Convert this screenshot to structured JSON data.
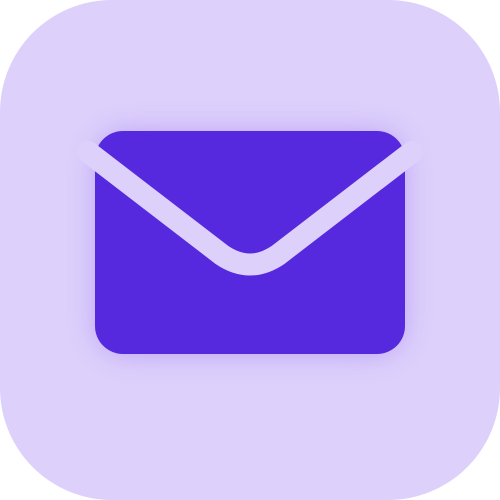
{
  "app_icon": {
    "icon_name": "envelope-icon",
    "meaning": "mail",
    "colors": {
      "tile_background": "#ddd0fb",
      "envelope_fill": "#5629df",
      "flap_divider": "#ddd0fb",
      "glow": "#7b4cf0"
    }
  }
}
